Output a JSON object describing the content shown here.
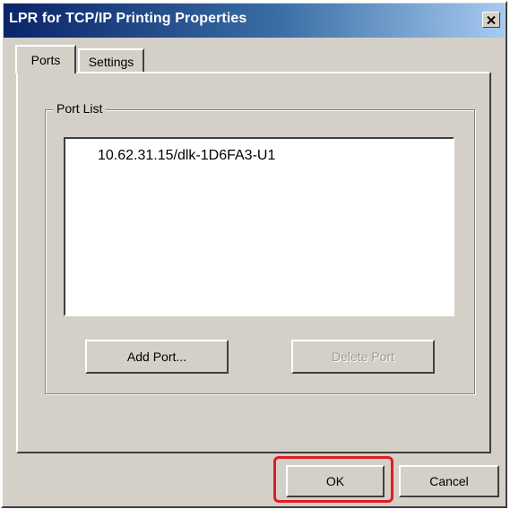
{
  "window": {
    "title": "LPR for TCP/IP Printing Properties",
    "close_icon": "close-x-icon"
  },
  "tabs": [
    {
      "label": "Ports",
      "active": true
    },
    {
      "label": "Settings",
      "active": false
    }
  ],
  "port_list": {
    "label": "Port List",
    "items": [
      "10.62.31.15/dlk-1D6FA3-U1"
    ]
  },
  "buttons": {
    "add_port": "Add Port...",
    "delete_port": "Delete Port",
    "ok": "OK",
    "cancel": "Cancel"
  },
  "colors": {
    "titlebar_start": "#0a246a",
    "titlebar_end": "#a6caf0",
    "dialog_face": "#d4d0c8",
    "highlight": "#e01c24"
  }
}
